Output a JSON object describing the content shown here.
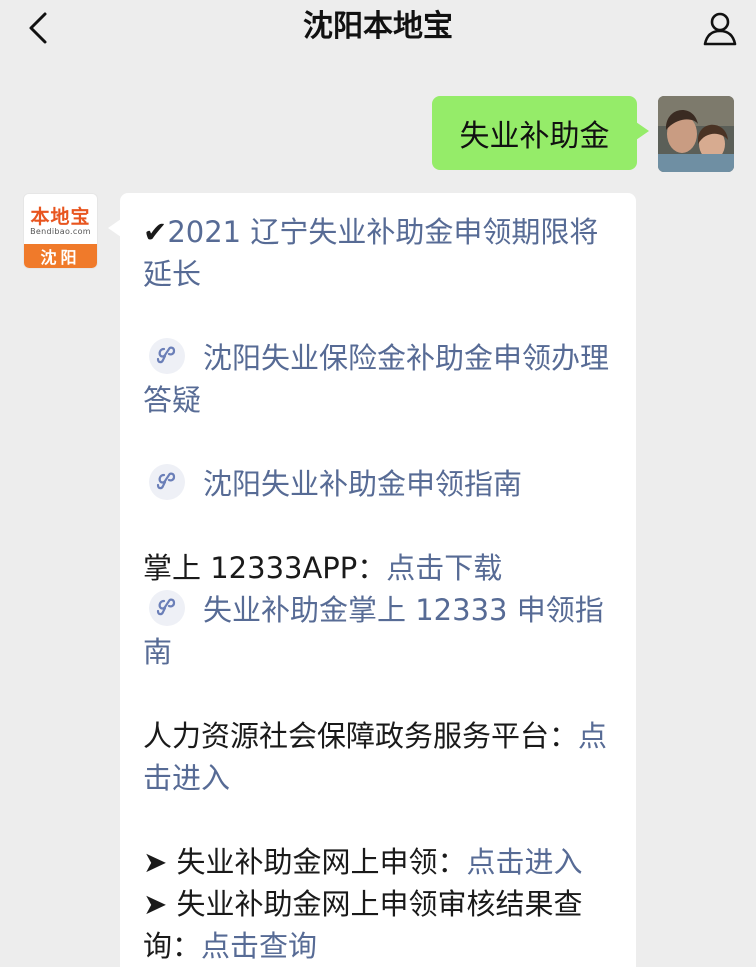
{
  "header": {
    "title": "沈阳本地宝",
    "back_icon": "chevron-left-icon",
    "profile_icon": "user-icon"
  },
  "outgoing_message": {
    "text": "失业补助金"
  },
  "sender": {
    "logo_main": "本地宝",
    "logo_sub": "Bendibao.com",
    "logo_city": "沈阳"
  },
  "reply": {
    "line1_mark": "✔",
    "line1_text": "2021 辽宁失业补助金申领期限将延长",
    "mini1_text": "沈阳失业保险金补助金申领办理答疑",
    "mini2_text": "沈阳失业补助金申领指南",
    "app_prefix": "掌上 12333APP：",
    "app_link": "点击下载",
    "mini3_text": "失业补助金掌上 12333 申领指南",
    "platform_text": "人力资源社会保障政务服务平台：",
    "platform_link": "点击进入",
    "apply_prefix": "➤ 失业补助金网上申领：",
    "apply_link": "点击进入",
    "result_prefix": "➤ 失业补助金网上申领审核结果查询：",
    "result_link": "点击查询"
  },
  "colors": {
    "background": "#ededed",
    "outgoing_bubble": "#95ec69",
    "incoming_bubble": "#ffffff",
    "link": "#576b95",
    "logo_orange": "#f07a2a"
  }
}
